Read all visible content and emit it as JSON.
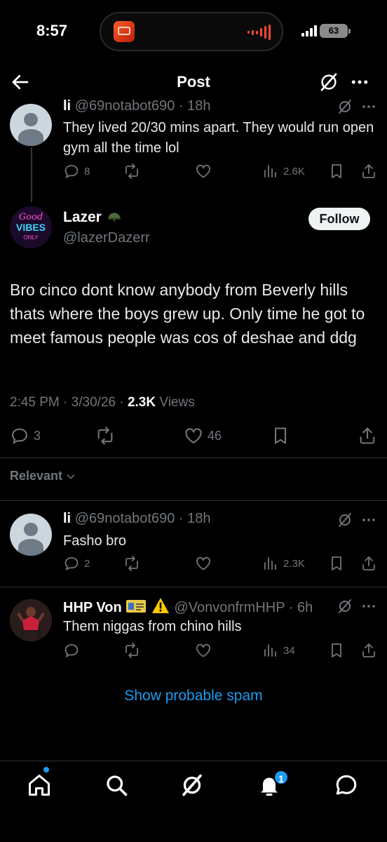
{
  "status": {
    "time": "8:57",
    "battery": "63"
  },
  "header": {
    "title": "Post"
  },
  "parent_reply": {
    "name": "li",
    "handle": "@69notabot690",
    "age": "· 18h",
    "text": "They lived 20/30 mins apart. They would run open gym all the time lol",
    "replies": "8",
    "views": "2.6K"
  },
  "main_post": {
    "name": "Lazer",
    "handle": "@lazerDazerr",
    "avatar_text": {
      "top": "Good",
      "mid": "VIBES",
      "bottom": "ONLY"
    },
    "follow_label": "Follow",
    "text": "Bro cinco dont know anybody from Beverly hills thats where the boys grew up. Only time he got to meet famous people was cos of deshae and ddg",
    "time": "2:45 PM",
    "date": "3/30/26",
    "views_count": "2.3K",
    "views_label": "Views",
    "replies": "3",
    "likes": "46"
  },
  "filter": {
    "label": "Relevant"
  },
  "replies": [
    {
      "name": "li",
      "handle": "@69notabot690",
      "age": "· 18h",
      "text": "Fasho bro",
      "replies": "2",
      "views": "2.3K"
    },
    {
      "name": "HHP Von",
      "handle": "@VonvonfrmHHP",
      "age": "· 6h",
      "text": "Them niggas from chino hills",
      "replies": "",
      "views": "34"
    }
  ],
  "spam_link": "Show probable spam",
  "bottom_nav": {
    "notifications_badge": "1"
  },
  "colors": {
    "accent": "#1d9bf0",
    "muted": "#71767b",
    "background": "#000000"
  }
}
